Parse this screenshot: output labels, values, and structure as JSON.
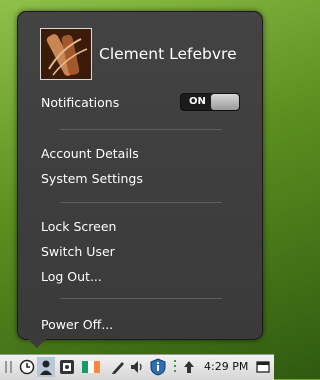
{
  "user": {
    "name": "Clement Lefebvre"
  },
  "notifications": {
    "label": "Notifications",
    "toggle_state": "ON"
  },
  "menu": {
    "account_details": "Account Details",
    "system_settings": "System Settings",
    "lock_screen": "Lock Screen",
    "switch_user": "Switch User",
    "log_out": "Log Out...",
    "power_off": "Power Off..."
  },
  "taskbar": {
    "time": "4:29 PM",
    "icons": [
      "clock-icon",
      "user-icon",
      "contacts-icon",
      "ireland-flag-icon",
      "pen-icon",
      "volume-icon",
      "shield-info-icon",
      "update-arrow-icon",
      "window-icon"
    ]
  }
}
